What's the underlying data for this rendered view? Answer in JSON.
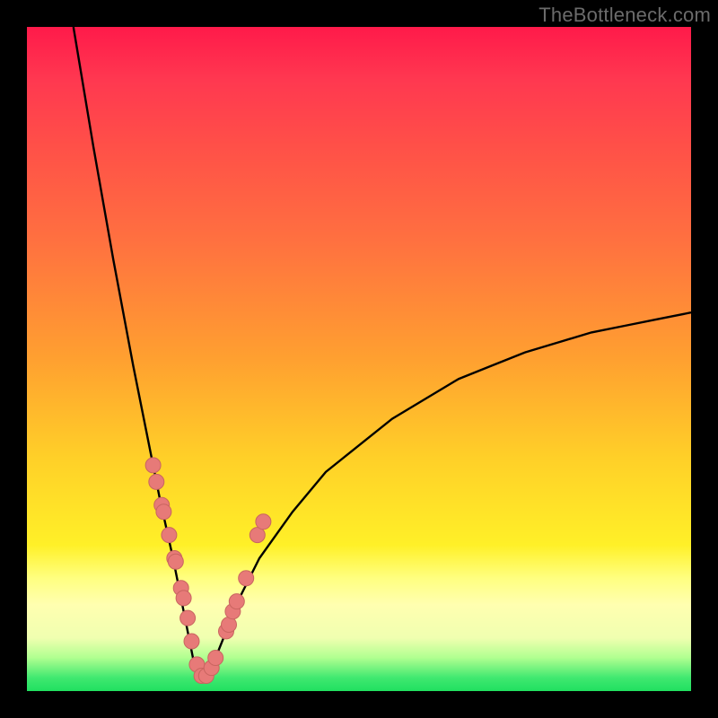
{
  "watermark": "TheBottleneck.com",
  "colors": {
    "frame": "#000000",
    "curve_stroke": "#000000",
    "dot_fill": "#e77a78",
    "dot_stroke": "#c96560"
  },
  "chart_data": {
    "type": "line",
    "title": "",
    "xlabel": "",
    "ylabel": "",
    "xlim": [
      0,
      100
    ],
    "ylim": [
      0,
      100
    ],
    "grid": false,
    "series": [
      {
        "name": "bottleneck-curve",
        "description": "V-shaped bottleneck % curve. Minimum (~0%) near x≈26; rises steeply toward 100% at x→0 and more gradually toward ~57% at x=100.",
        "x": [
          7,
          10,
          13,
          16,
          18,
          20,
          22,
          24,
          25,
          26,
          27,
          28,
          30,
          32,
          35,
          40,
          45,
          50,
          55,
          60,
          65,
          70,
          75,
          80,
          85,
          90,
          95,
          100
        ],
        "y": [
          100,
          82,
          65,
          49,
          39,
          29,
          20,
          10,
          5,
          2,
          2,
          4,
          9,
          14,
          20,
          27,
          33,
          37,
          41,
          44,
          47,
          49,
          51,
          52.5,
          54,
          55,
          56,
          57
        ]
      }
    ],
    "points": {
      "name": "sample-dots",
      "description": "Salmon-colored sample dots clustered along lower portion of the V",
      "x": [
        19.0,
        19.5,
        20.3,
        20.6,
        21.4,
        22.2,
        22.4,
        23.2,
        23.6,
        24.2,
        24.8,
        25.6,
        26.3,
        27.0,
        27.8,
        28.4,
        30.0,
        30.4,
        31.0,
        31.6,
        33.0,
        34.7,
        35.6
      ],
      "y": [
        34.0,
        31.5,
        28.0,
        27.0,
        23.5,
        20.0,
        19.5,
        15.5,
        14.0,
        11.0,
        7.5,
        4.0,
        2.3,
        2.3,
        3.5,
        5.0,
        9.0,
        10.0,
        12.0,
        13.5,
        17.0,
        23.5,
        25.5
      ]
    }
  }
}
